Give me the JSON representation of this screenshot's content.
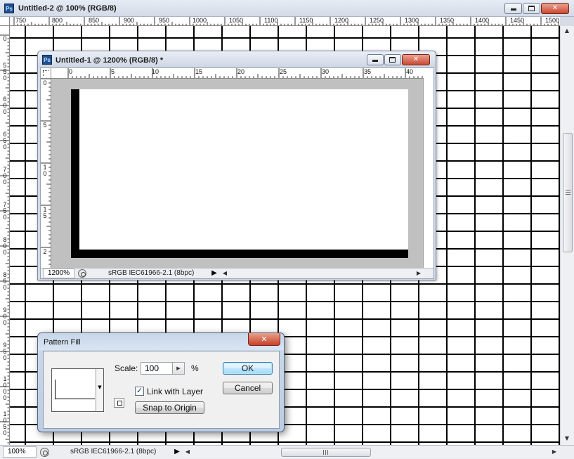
{
  "outer_window": {
    "app_badge": "Ps",
    "title": "Untitled-2 @ 100% (RGB/8)",
    "ruler_h_labels": [
      "750",
      "800",
      "850",
      "900",
      "950",
      "1000",
      "1050",
      "1100",
      "1150",
      "1200",
      "1250",
      "1300",
      "1350",
      "1400",
      "1450",
      "1500"
    ],
    "ruler_v_labels": [
      "0",
      "5 5 0",
      "6 0 0",
      "6 5 0",
      "7 0 0",
      "7 5 0",
      "8 0 0",
      "8 5 0",
      "9 0 0",
      "9 5 0",
      "1 0 0 0",
      "1 0 5 0"
    ],
    "status": {
      "zoom": "100%",
      "color_profile": "sRGB IEC61966-2.1 (8bpc)"
    },
    "icons": {
      "minimize": "minimize-icon",
      "maximize": "maximize-icon",
      "close": "close-icon"
    }
  },
  "inner_window": {
    "app_badge": "Ps",
    "title": "Untitled-1 @ 1200% (RGB/8) *",
    "ruler_h_labels": [
      "0",
      "5",
      "10",
      "15",
      "20",
      "25",
      "30",
      "35",
      "40"
    ],
    "ruler_v_labels": [
      "0",
      "5",
      "1 0",
      "1 5",
      "2"
    ],
    "status": {
      "zoom": "1200%",
      "color_profile": "sRGB IEC61966-2.1 (8bpc)"
    }
  },
  "pattern_fill_dialog": {
    "title": "Pattern Fill",
    "scale_label": "Scale:",
    "scale_value": "100",
    "scale_unit": "%",
    "link_with_layer_label": "Link with Layer",
    "link_with_layer_checked": true,
    "snap_to_origin_label": "Snap to Origin",
    "ok_label": "OK",
    "cancel_label": "Cancel"
  }
}
